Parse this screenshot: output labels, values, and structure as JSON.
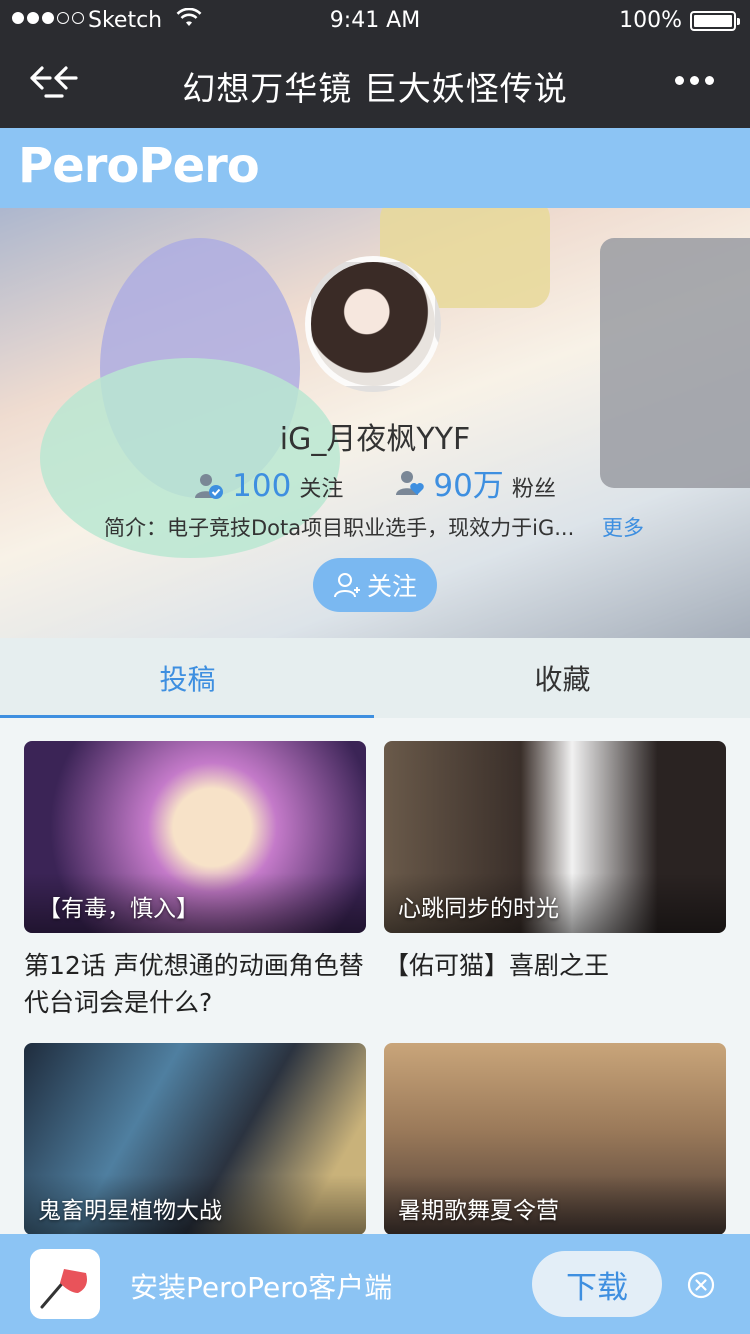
{
  "status_bar": {
    "carrier": "Sketch",
    "time": "9:41 AM",
    "battery": "100%"
  },
  "nav": {
    "title": "幻想万华镜 巨大妖怪传说"
  },
  "brand": {
    "logo": "PeroPero"
  },
  "profile": {
    "username": "iG_月夜枫YYF",
    "following_count": "100",
    "following_label": "关注",
    "followers_count": "90万",
    "followers_label": "粉丝",
    "bio": "简介：电子竞技Dota项目职业选手，现效力于iG...",
    "bio_more": "更多",
    "follow_button": "关注"
  },
  "tabs": [
    {
      "label": "投稿",
      "active": true
    },
    {
      "label": "收藏",
      "active": false
    }
  ],
  "posts": [
    {
      "thumb_label": "【有毒，慎入】",
      "title": "第12话  声优想通的动画角色替代台词会是什么?"
    },
    {
      "thumb_label": "心跳同步的时光",
      "title": "【佑可猫】喜剧之王"
    },
    {
      "thumb_label": "鬼畜明星植物大战",
      "title": ""
    },
    {
      "thumb_label": "暑期歌舞夏令营",
      "title": ""
    }
  ],
  "install_banner": {
    "text": "安装PeroPero客户端",
    "download_button": "下载"
  },
  "colors": {
    "accent": "#3e8fe0",
    "brand": "#8cc4f4",
    "nav_bg": "#2b2c30"
  }
}
